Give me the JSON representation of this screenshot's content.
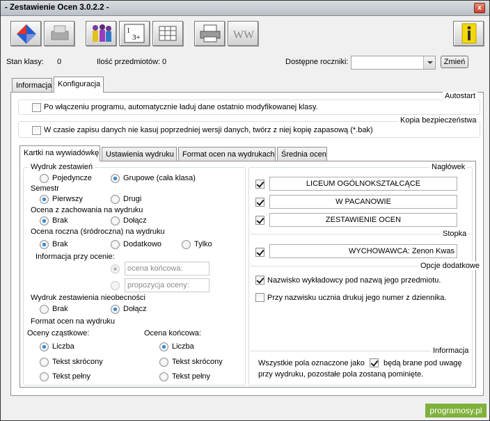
{
  "window": {
    "title": "- Zestawienie Ocen 3.0.2.2 -",
    "close": "x"
  },
  "toolbar": {
    "buttons": [
      "flag-icon",
      "shred-icon",
      "students-icon",
      "grades-sheet-icon",
      "table-icon",
      "printer-icon",
      "www-icon",
      "info-icon"
    ]
  },
  "infobar": {
    "class_status_label": "Stan klasy:",
    "class_status_value": "0",
    "subjects_label": "Ilość przedmiotów:",
    "subjects_value": "0",
    "years_label": "Dostępne roczniki:",
    "years_value": "",
    "change_button": "Zmień"
  },
  "main_tabs": [
    "Informacja",
    "Konfiguracja"
  ],
  "autostart": {
    "title": "Autostart",
    "option": "Po włączeniu programu, automatycznie ładuj dane ostatnio modyfikowanej klasy.",
    "checked": false
  },
  "backup": {
    "title": "Kopia bezpieczeństwa",
    "option": "W czasie zapisu danych nie kasuj poprzedniej wersji danych, twórz z niej kopię zapasową (*.bak)",
    "checked": false
  },
  "sub_tabs": [
    "Kartki na wywiadówkę",
    "Ustawienia wydruku",
    "Format ocen na wydrukach",
    "Średnia ocen"
  ],
  "left": {
    "print_type": {
      "title": "Wydruk zestawień",
      "opt1": "Pojedyncze",
      "opt2": "Grupowe (cała klasa)",
      "selected": 2
    },
    "semester": {
      "title": "Semestr",
      "opt1": "Pierwszy",
      "opt2": "Drugi",
      "selected": 1
    },
    "behavior": {
      "title": "Ocena z zachowania na wydruku",
      "opt1": "Brak",
      "opt2": "Dołącz",
      "selected": 1
    },
    "annual": {
      "title": "Ocena roczna (śródroczna) na wydruku",
      "opt1": "Brak",
      "opt2": "Dodatkowo",
      "opt3": "Tylko",
      "selected": 1,
      "info_label": "Informacja przy ocenie:",
      "final_placeholder": "ocena końcowa:",
      "proposal_placeholder": "propozycja oceny:"
    },
    "absence": {
      "title": "Wydruk zestawienia nieobecności",
      "opt1": "Brak",
      "opt2": "Dołącz",
      "selected": 2
    },
    "format": {
      "title": "Format ocen na wydruku",
      "partial_label": "Oceny cząstkowe:",
      "final_label": "Ocena końcowa:",
      "opt1": "Liczba",
      "opt2": "Tekst skrócony",
      "opt3": "Tekst pełny",
      "partial_selected": 1,
      "final_selected": 1
    }
  },
  "right": {
    "header": {
      "title": "Nagłówek",
      "lines": [
        "LICEUM OGÓLNOKSZTAŁCĄCE",
        "W PACANOWIE",
        "ZESTAWIENIE OCEN"
      ]
    },
    "footer": {
      "title": "Stopka",
      "line": "WYCHOWAWCA: Zenon Kwas"
    },
    "extra": {
      "title": "Opcje dodatkowe",
      "opt1": "Nazwisko wykładowcy pod nazwą jego przedmiotu.",
      "opt2": "Przy nazwisku ucznia drukuj jego numer z dziennika."
    },
    "info": {
      "title": "Informacja",
      "text1": "Wszystkie pola oznaczone jako",
      "text2": "będą brane pod uwagę",
      "text3": "przy wydruku, pozostałe pola zostaną pominięte."
    }
  },
  "watermark": "programosy.pl"
}
